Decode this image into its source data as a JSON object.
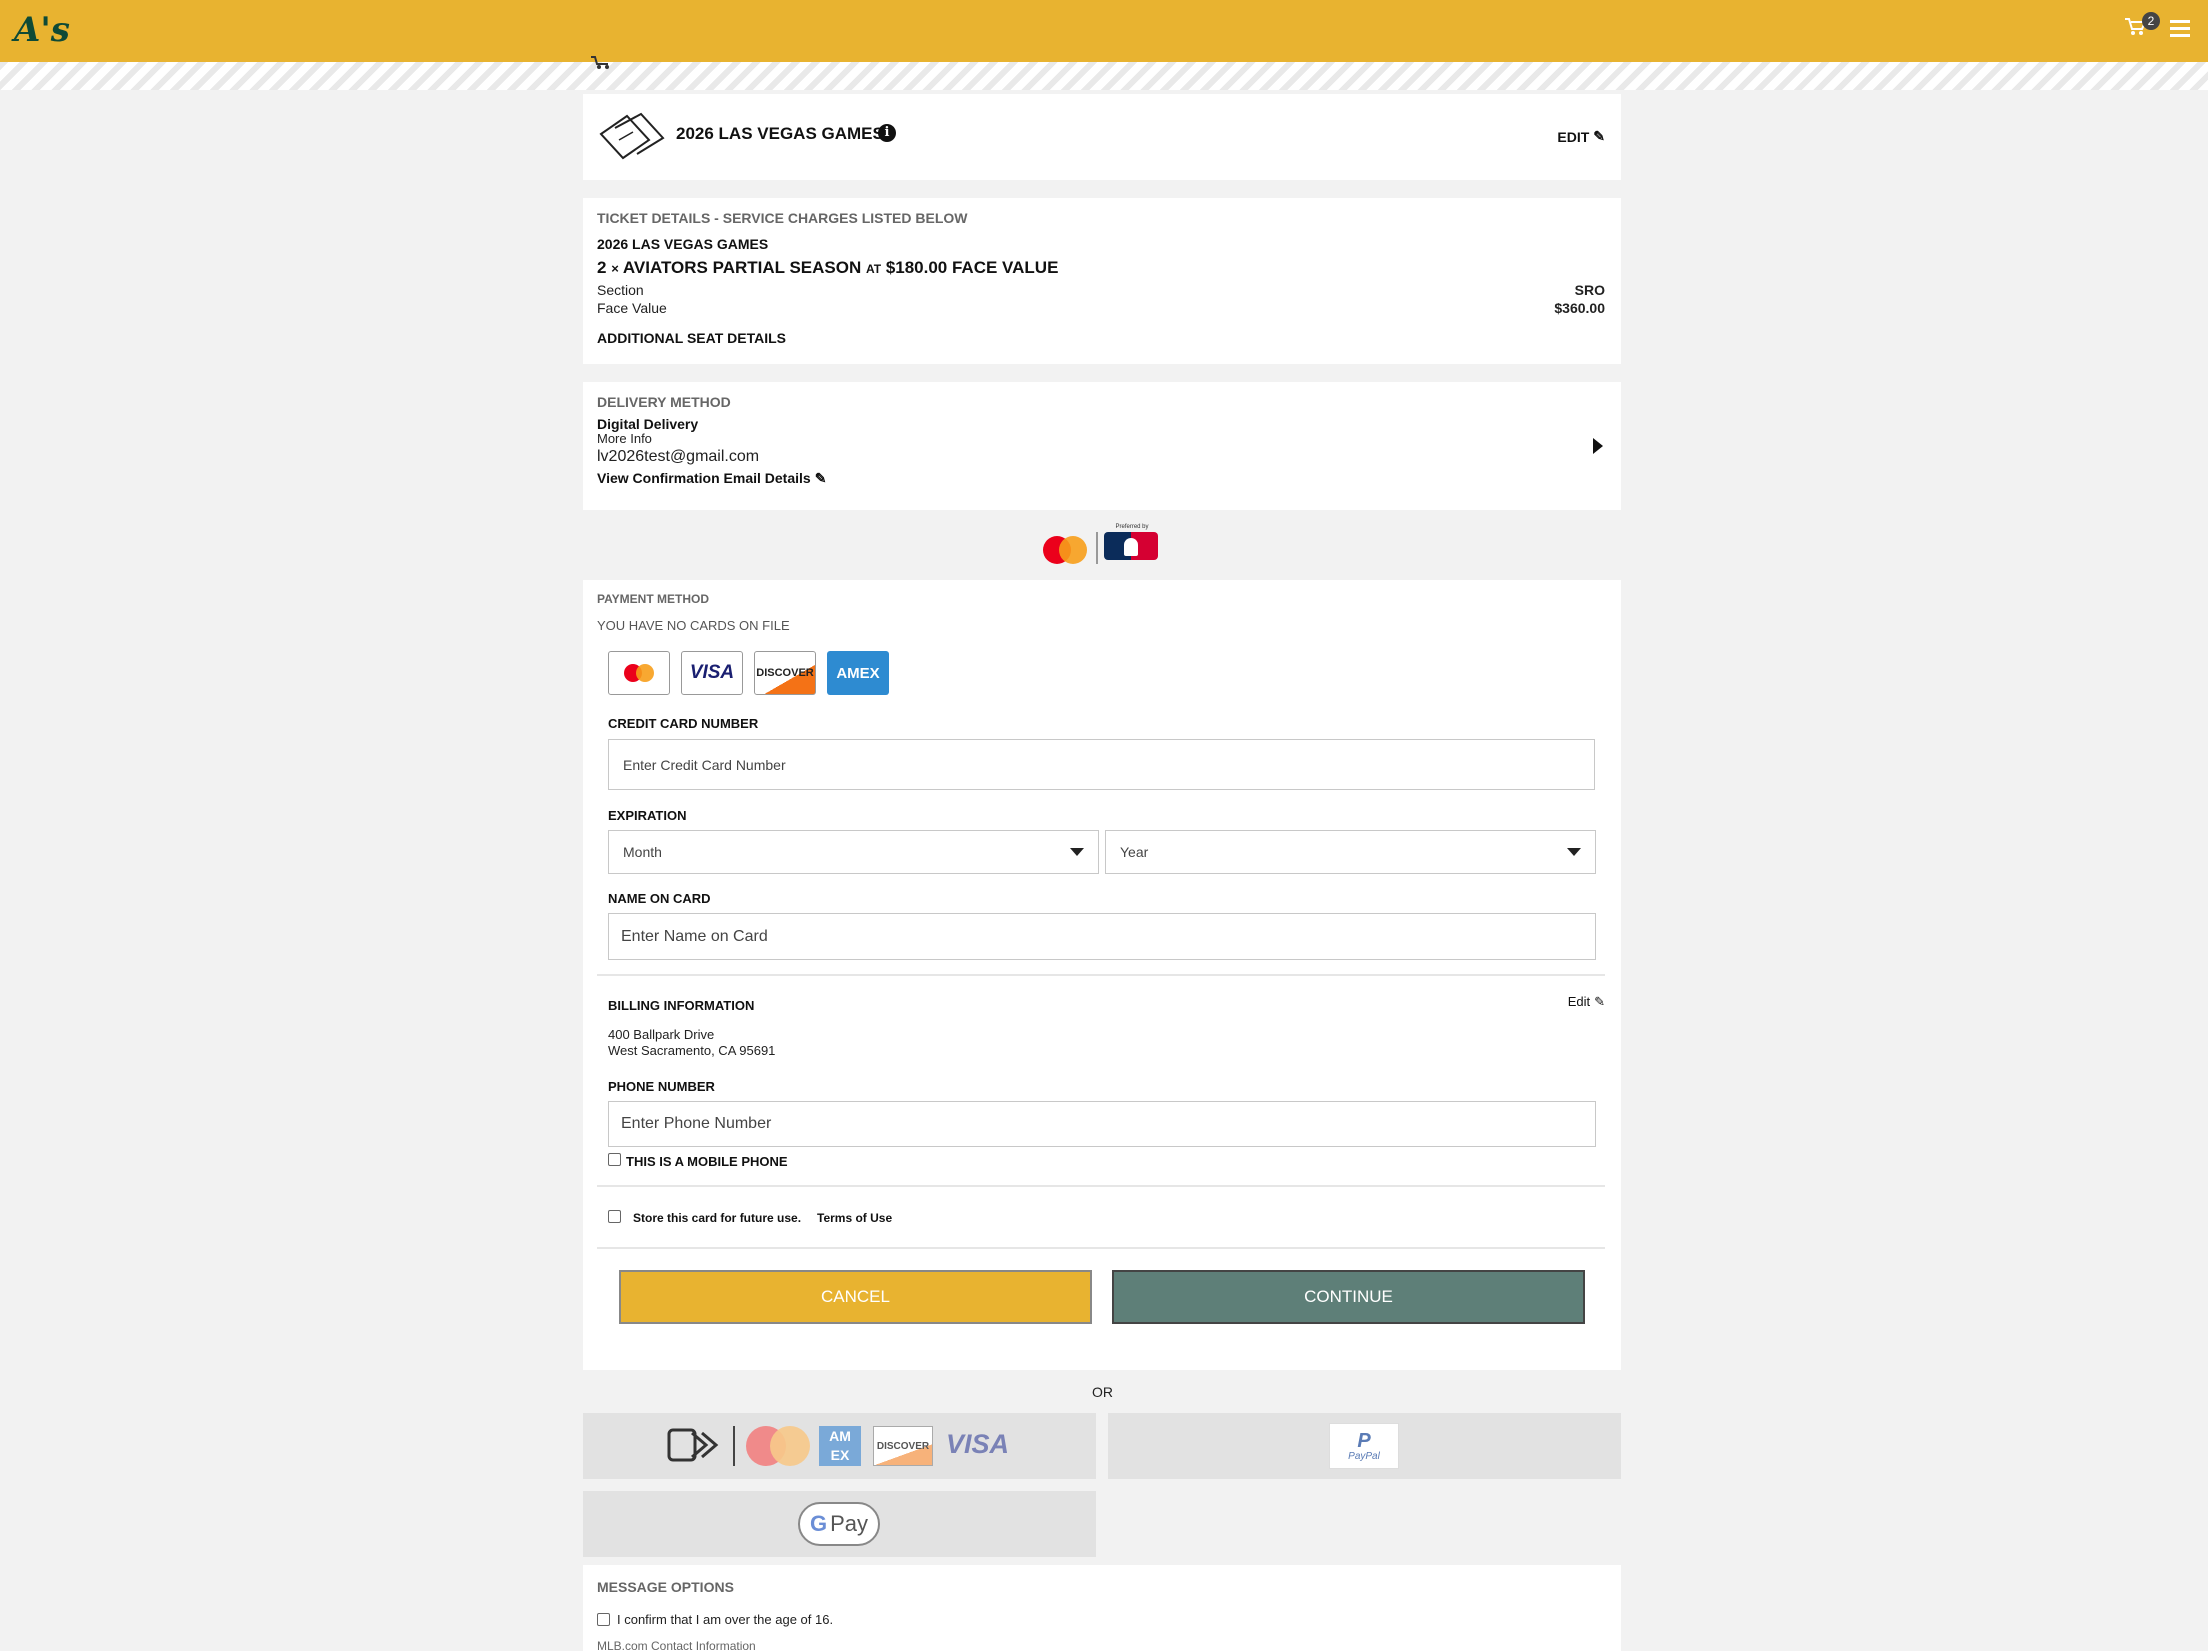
{
  "header": {
    "logo_text": "A's",
    "cart_count": "2"
  },
  "event": {
    "title": "2026 LAS VEGAS GAMES",
    "edit_label": "EDIT"
  },
  "ticket": {
    "section_title": "TICKET DETAILS - SERVICE CHARGES LISTED BELOW",
    "event_name": "2026 LAS VEGAS GAMES",
    "qty": "2",
    "times": "×",
    "product": "AVIATORS PARTIAL SEASON",
    "at": "AT",
    "price": "$180.00 FACE VALUE",
    "section_label": "Section",
    "section_value": "SRO",
    "face_label": "Face Value",
    "face_value": "$360.00",
    "additional": "ADDITIONAL SEAT DETAILS"
  },
  "delivery": {
    "section_title": "DELIVERY METHOD",
    "method": "Digital Delivery",
    "more_info": "More Info",
    "email": "lv2026test@gmail.com",
    "view_confirmation": "View Confirmation Email Details"
  },
  "sponsor": {
    "preferred_text": "Preferred by"
  },
  "payment": {
    "section_title": "PAYMENT METHOD",
    "no_cards": "YOU HAVE NO CARDS ON FILE",
    "card_visa": "VISA",
    "card_discover": "DISCOVER",
    "card_amex": "AMEX",
    "cc_label": "CREDIT CARD NUMBER",
    "cc_placeholder": "Enter Credit Card Number",
    "exp_label": "EXPIRATION",
    "month": "Month",
    "year": "Year",
    "name_label": "NAME ON CARD",
    "name_placeholder": "Enter Name on Card",
    "billing_label": "BILLING INFORMATION",
    "billing_edit": "Edit",
    "address1": "400 Ballpark Drive",
    "address2": "West Sacramento, CA 95691",
    "phone_label": "PHONE NUMBER",
    "phone_placeholder": "Enter Phone Number",
    "mobile_label": "THIS IS A MOBILE PHONE",
    "store_label": "Store this card for future use.",
    "terms": "Terms of Use",
    "cancel": "CANCEL",
    "continue": "CONTINUE"
  },
  "alt": {
    "or": "OR",
    "amex_short": "AM EX",
    "discover": "DISCOVER",
    "visa": "VISA",
    "paypal": "PayPal",
    "gpay": "Pay"
  },
  "messages": {
    "section_title": "MESSAGE OPTIONS",
    "age_confirm": "I confirm that I am over the age of 16.",
    "contact": "MLB.com Contact Information"
  },
  "colors": {
    "brand_gold": "#e8b330",
    "brand_green": "#0e4a36",
    "continue_bg": "#5e7f78",
    "cancel_bg": "#e8b330"
  }
}
